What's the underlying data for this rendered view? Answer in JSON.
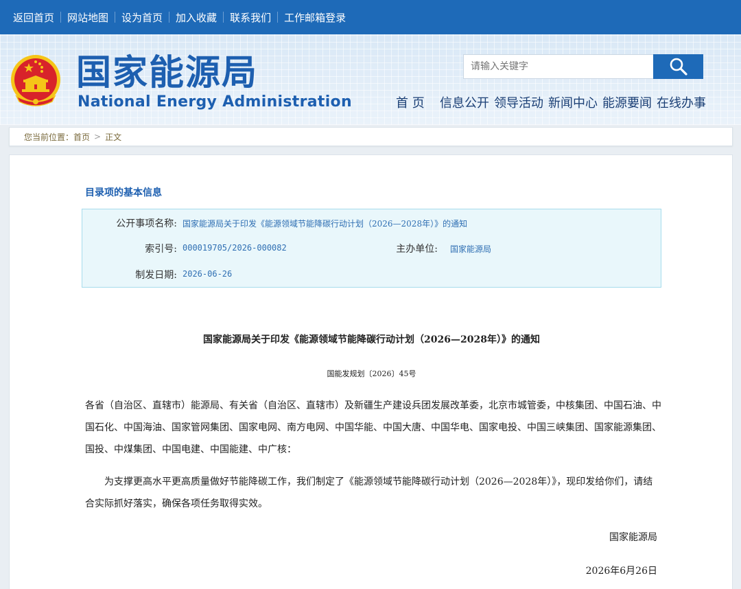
{
  "topnav": {
    "items": [
      "返回首页",
      "网站地图",
      "设为首页",
      "加入收藏",
      "联系我们",
      "工作邮箱登录"
    ]
  },
  "header": {
    "logo_cn": "国家能源局",
    "logo_en": "National Energy Administration",
    "search_placeholder": "请输入关键字",
    "search_icon": "search-icon",
    "nav": [
      "首 页",
      "信息公开",
      "领导活动",
      "新闻中心",
      "能源要闻",
      "在线办事"
    ]
  },
  "breadcrumb": {
    "prefix": "您当前位置：",
    "home": "首页",
    "separator": ">",
    "current": "正文"
  },
  "info": {
    "section_title": "目录项的基本信息",
    "name_label": "公开事项名称:",
    "name_value": "国家能源局关于印发《能源领域节能降碳行动计划（2026—2028年）》的通知",
    "index_label": "索引号:",
    "index_value": "000019705/2026-000082",
    "org_label": "主办单位:",
    "org_value": "国家能源局",
    "date_label": "制发日期:",
    "date_value": "2026-06-26"
  },
  "document": {
    "title": "国家能源局关于印发《能源领域节能降碳行动计划（2026—2028年）》的通知",
    "doc_number": "国能发规划〔2026〕45号",
    "recipients": "各省（自治区、直辖市）能源局、有关省（自治区、直辖市）及新疆生产建设兵团发展改革委，北京市城管委，中核集团、中国石油、中国石化、中国海油、国家管网集团、国家电网、南方电网、中国华能、中国大唐、中国华电、国家电投、中国三峡集团、国家能源集团、国投、中煤集团、中国电建、中国能建、中广核：",
    "body": "为支撑更高水平更高质量做好节能降碳工作，我们制定了《能源领域节能降碳行动计划（2026—2028年）》，现印发给你们，请结合实际抓好落实，确保各项任务取得实效。",
    "signature": "国家能源局",
    "sign_date": "2026年6月26日"
  },
  "colors": {
    "primary_blue": "#1e6ab8",
    "logo_blue": "#1d5fb0",
    "info_bg": "#e9f7fb",
    "info_border": "#a6dcec",
    "emblem_red": "#d8232a",
    "emblem_gold": "#f5c518"
  }
}
